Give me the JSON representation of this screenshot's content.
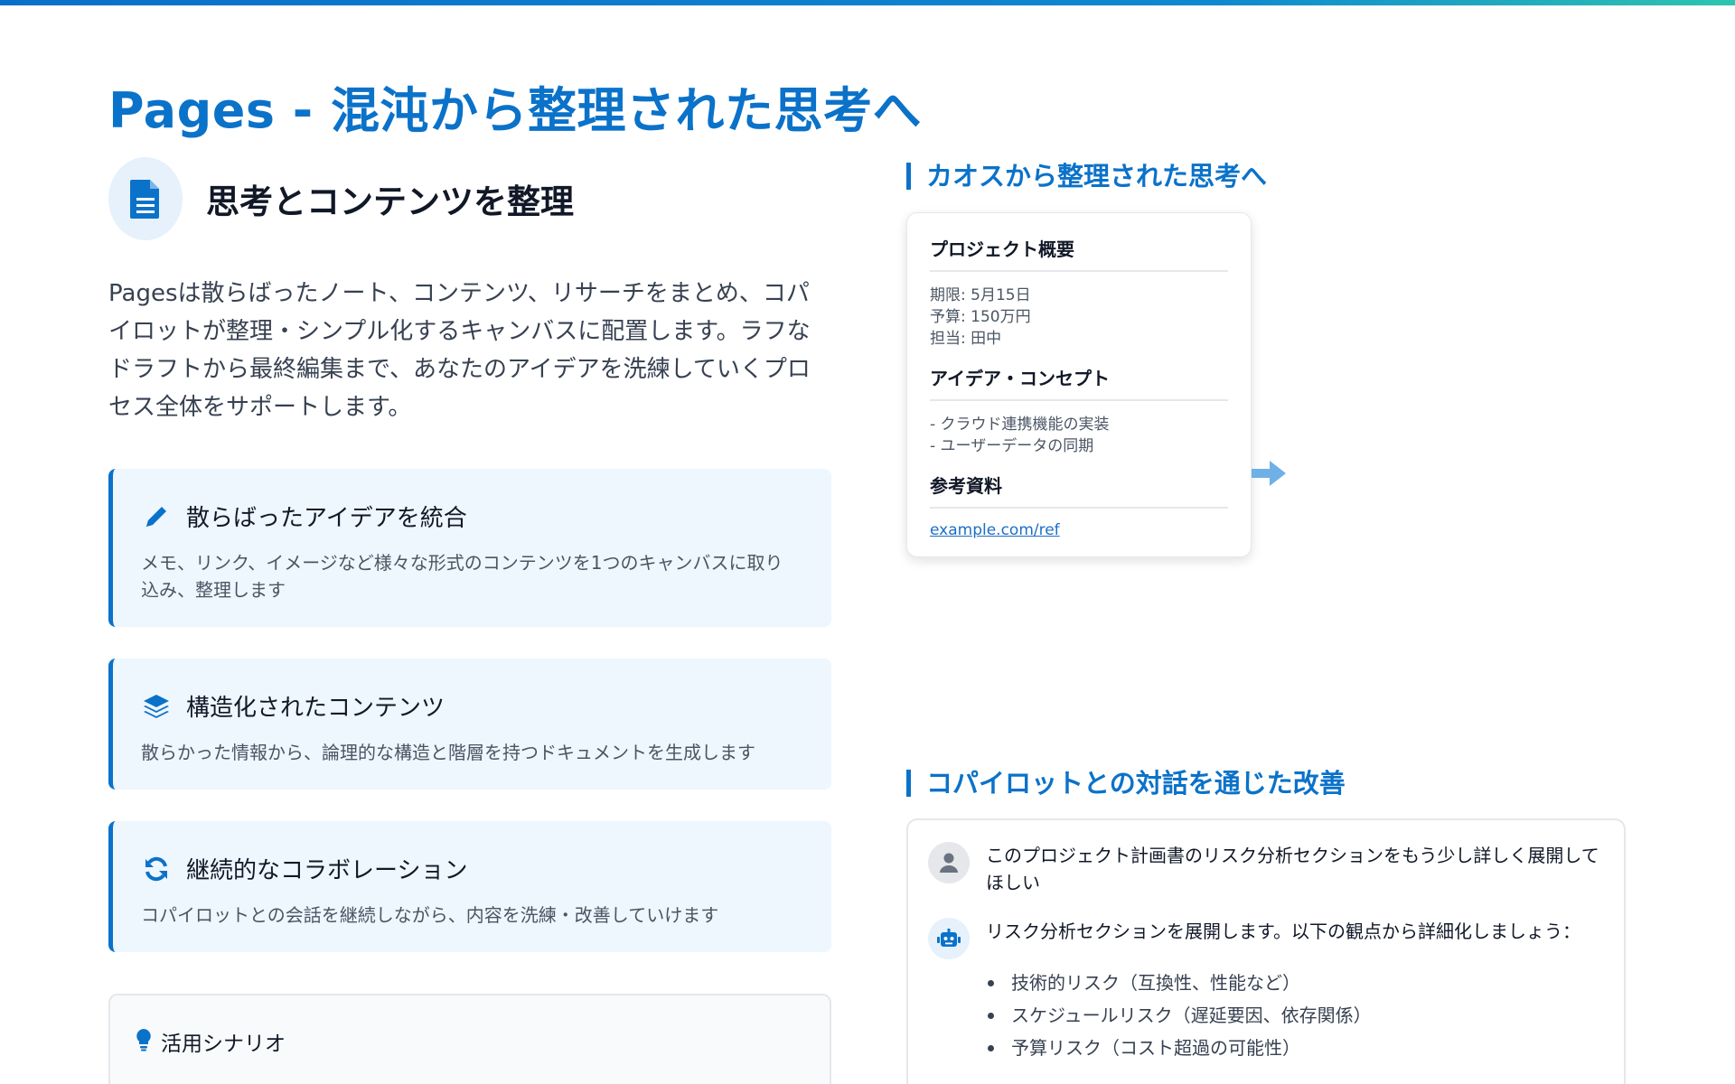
{
  "header": {
    "title": "Pages - 混沌から整理された思考へ"
  },
  "hero": {
    "icon": "document-icon",
    "title": "思考とコンテンツを整理"
  },
  "intro": "Pagesは散らばったノート、コンテンツ、リサーチをまとめ、コパイロットが整理・シンプル化するキャンバスに配置します。ラフなドラフトから最終編集まで、あなたのアイデアを洗練していくプロセス全体をサポートします。",
  "features": [
    {
      "icon": "pencil-icon",
      "title": "散らばったアイデアを統合",
      "desc": "メモ、リンク、イメージなど様々な形式のコンテンツを1つのキャンバスに取り込み、整理します"
    },
    {
      "icon": "layers-icon",
      "title": "構造化されたコンテンツ",
      "desc": "散らかった情報から、論理的な構造と階層を持つドキュメントを生成します"
    },
    {
      "icon": "sync-icon",
      "title": "継続的なコラボレーション",
      "desc": "コパイロットとの会話を継続しながら、内容を洗練・改善していけます"
    }
  ],
  "scenario": {
    "icon": "lightbulb-icon",
    "title": "活用シナリオ"
  },
  "sections": {
    "chaos_title": "カオスから整理された思考へ",
    "dialog_title": "コパイロットとの対話を通じた改善"
  },
  "doc_card": {
    "h1": "プロジェクト概要",
    "lines1": [
      "期限: 5月15日",
      "予算: 150万円",
      "担当: 田中"
    ],
    "h2": "アイデア・コンセプト",
    "lines2": [
      "- クラウド連携機能の実装",
      "- ユーザーデータの同期"
    ],
    "h3": "参考資料",
    "link": "example.com/ref"
  },
  "chat": {
    "user_msg": "このプロジェクト計画書のリスク分析セクションをもう少し詳しく展開してほしい",
    "bot_msg": "リスク分析セクションを展開します。以下の観点から詳細化しましょう：",
    "bullets": [
      "技術的リスク（互換性、性能など）",
      "スケジュールリスク（遅延要因、依存関係）",
      "予算リスク（コスト超過の可能性）"
    ]
  },
  "colors": {
    "accent": "#0b72c9",
    "card_bg": "#eef6fe",
    "arrow": "#6fb0e6"
  }
}
